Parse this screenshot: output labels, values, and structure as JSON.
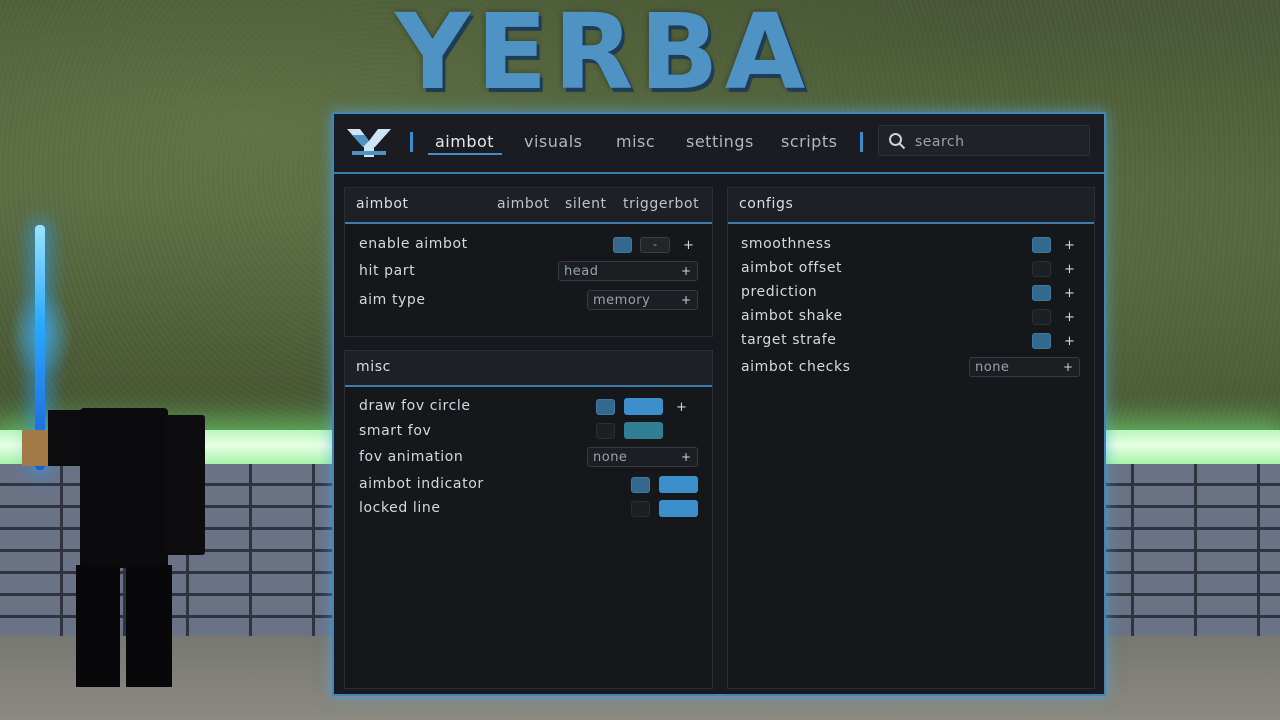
{
  "scene": {
    "logo_text": "YERBA"
  },
  "menu": {
    "tabs": [
      {
        "label": "aimbot",
        "active": true
      },
      {
        "label": "visuals",
        "active": false
      },
      {
        "label": "misc",
        "active": false
      },
      {
        "label": "settings",
        "active": false
      },
      {
        "label": "scripts",
        "active": false
      }
    ],
    "search": {
      "placeholder": "search",
      "value": ""
    },
    "accent_color": "#3e8fcb"
  },
  "aimbot_panel": {
    "title": "aimbot",
    "subtabs": [
      "aimbot",
      "silent",
      "triggerbot"
    ],
    "rows": {
      "enable_aimbot": {
        "label": "enable aimbot",
        "enabled": true,
        "keybind": "-",
        "plus": "+"
      },
      "hit_part": {
        "label": "hit part",
        "value": "head",
        "plus": "+"
      },
      "aim_type": {
        "label": "aim type",
        "value": "memory",
        "plus": "+"
      }
    }
  },
  "misc_panel": {
    "title": "misc",
    "rows": {
      "draw_fov_circle": {
        "label": "draw fov circle",
        "enabled": true,
        "color": "#3d8fcc",
        "plus": "+"
      },
      "smart_fov": {
        "label": "smart fov",
        "enabled": false,
        "color": "#327f94"
      },
      "fov_animation": {
        "label": "fov animation",
        "value": "none",
        "plus": "+"
      },
      "aimbot_indicator": {
        "label": "aimbot indicator",
        "enabled": true,
        "color": "#3d8fcc"
      },
      "locked_line": {
        "label": "locked line",
        "enabled": false,
        "color": "#3d8fcc"
      }
    }
  },
  "configs_panel": {
    "title": "configs",
    "rows": {
      "smoothness": {
        "label": "smoothness",
        "enabled": true,
        "plus": "+"
      },
      "aimbot_offset": {
        "label": "aimbot offset",
        "enabled": false,
        "plus": "+"
      },
      "prediction": {
        "label": "prediction",
        "enabled": true,
        "plus": "+"
      },
      "aimbot_shake": {
        "label": "aimbot shake",
        "enabled": false,
        "plus": "+"
      },
      "target_strafe": {
        "label": "target strafe",
        "enabled": true,
        "plus": "+"
      },
      "aimbot_checks": {
        "label": "aimbot checks",
        "value": "none",
        "plus": "+"
      }
    }
  }
}
